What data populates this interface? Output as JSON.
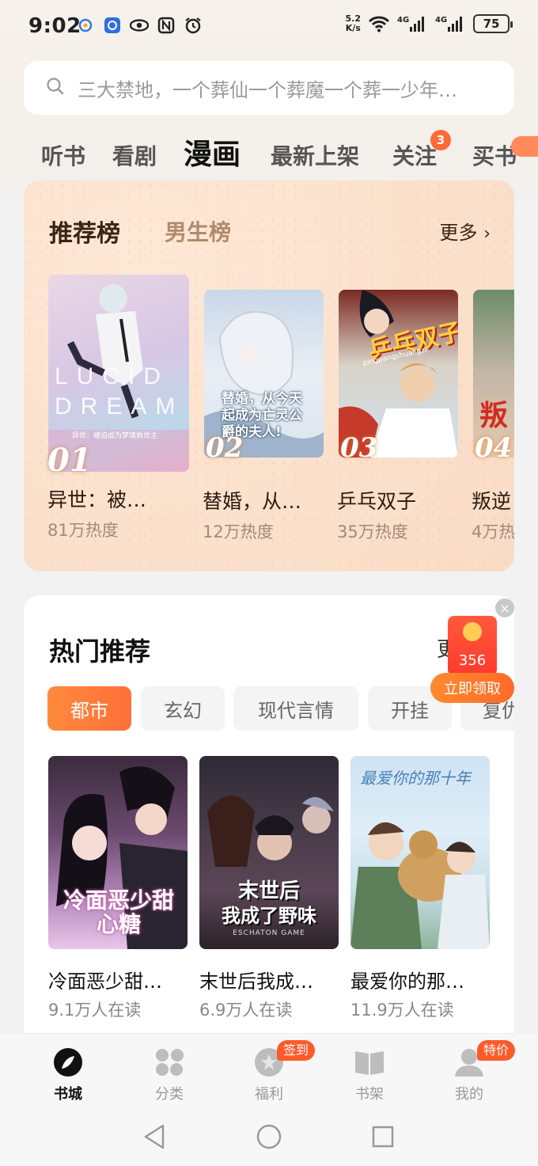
{
  "status": {
    "time": "9:02",
    "net_speed_top": "5.2",
    "net_speed_bottom": "K/s",
    "battery": "75"
  },
  "search": {
    "placeholder": "三大禁地，一个葬仙一个葬魔一个葬一少年…"
  },
  "tabs": [
    {
      "label": "听书"
    },
    {
      "label": "看剧"
    },
    {
      "label": "漫画"
    },
    {
      "label": "最新上架"
    },
    {
      "label": "关注",
      "badge": "3"
    },
    {
      "label": "买书"
    }
  ],
  "rank": {
    "tab_active": "推荐榜",
    "tab_other": "男生榜",
    "more": "更多",
    "books": [
      {
        "rank": "01",
        "title": "异世：被…",
        "heat": "81万热度"
      },
      {
        "rank": "02",
        "title": "替婚，从…",
        "heat": "12万热度"
      },
      {
        "rank": "03",
        "title": "乒乓双子",
        "heat": "35万热度"
      },
      {
        "rank": "04",
        "title": "叛逆",
        "heat": "4万热"
      }
    ],
    "cover_text": {
      "c1_line1": "LUCID",
      "c1_line2": "DREAM",
      "c1_sub": "异世：被迫成为梦境救世主",
      "c2_text": "替婚，从今天起成为亡灵公爵的夫人!",
      "c3_text": "乒乓双子",
      "c3_sub": "pingpangshuangzi",
      "c4_text": "叛"
    }
  },
  "hot": {
    "title": "热门推荐",
    "more": "更",
    "chips": [
      "都市",
      "玄幻",
      "现代言情",
      "开挂",
      "复仇"
    ],
    "books": [
      {
        "title": "冷面恶少甜…",
        "readers": "9.1万人在读",
        "cover": "冷面恶少甜心糖"
      },
      {
        "title": "末世后我成…",
        "readers": "6.9万人在读",
        "cover_line1": "末世后",
        "cover_line2": "我成了野味",
        "cover_sub": "ESCHATON GAME"
      },
      {
        "title": "最爱你的那…",
        "readers": "11.9万人在读",
        "cover": "最爱你的那十年"
      }
    ]
  },
  "packet": {
    "amount": "356",
    "button": "立即领取",
    "close": "×"
  },
  "bottom_nav": [
    {
      "label": "书城"
    },
    {
      "label": "分类"
    },
    {
      "label": "福利",
      "badge": "签到"
    },
    {
      "label": "书架"
    },
    {
      "label": "我的",
      "badge": "特价"
    }
  ],
  "colors": {
    "accent": "#ff6f3a",
    "rank_bg": "#fbe1cc",
    "badge": "#ff5a2c"
  }
}
